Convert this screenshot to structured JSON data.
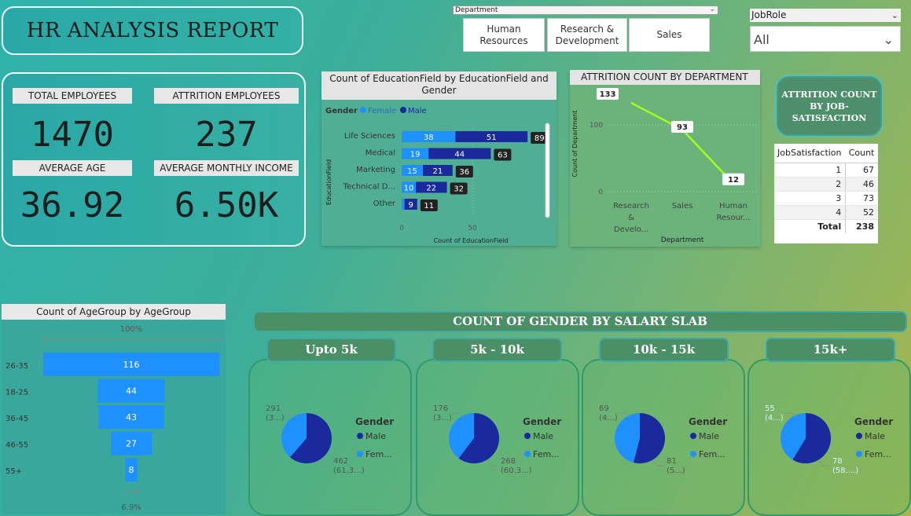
{
  "title": "HR ANALYSIS REPORT",
  "department_slicer": {
    "label": "Department",
    "options": [
      "Human Resources",
      "Research & Development",
      "Sales"
    ]
  },
  "jobrole_slicer": {
    "label": "JobRole",
    "value": "All"
  },
  "kpis": {
    "total_employees": {
      "label": "TOTAL EMPLOYEES",
      "value": "1470"
    },
    "attrition_employees": {
      "label": "ATTRITION EMPLOYEES",
      "value": "237"
    },
    "average_age": {
      "label": "AVERAGE AGE",
      "value": "36.92"
    },
    "average_monthly_income": {
      "label": "AVERAGE MONTHLY INCOME",
      "value": "6.50K"
    }
  },
  "colors": {
    "female": "#1e90ff",
    "male": "#1a2a9c",
    "line": "#a6ff1a"
  },
  "chart_data": [
    {
      "type": "bar",
      "title": "Count of EducationField by EducationField and Gender",
      "legend_title": "Gender",
      "legend": [
        "Female",
        "Male"
      ],
      "ylabel": "EducationField",
      "xlabel": "Count of EducationField",
      "x_ticks": [
        "0",
        "50"
      ],
      "xlim": [
        0,
        100
      ],
      "categories": [
        "Life Sciences",
        "Medical",
        "Marketing",
        "Technical D...",
        "Other"
      ],
      "series": [
        {
          "name": "Female",
          "values": [
            38,
            19,
            15,
            10,
            2
          ]
        },
        {
          "name": "Male",
          "values": [
            51,
            44,
            21,
            22,
            9
          ]
        }
      ],
      "totals": [
        89,
        63,
        36,
        32,
        11
      ],
      "segment_labels": [
        [
          "38",
          "51"
        ],
        [
          "19",
          "44"
        ],
        [
          "15",
          "21"
        ],
        [
          "10",
          "22"
        ],
        [
          "",
          "9"
        ]
      ]
    },
    {
      "type": "line",
      "title": "ATTRITION COUNT BY DEPARTMENT",
      "xlabel": "Department",
      "ylabel": "Count of Department",
      "categories": [
        "Research & Develo...",
        "Sales",
        "Human Resour..."
      ],
      "category_lines": [
        [
          "Research",
          "&",
          "Develo..."
        ],
        [
          "Sales"
        ],
        [
          "Human",
          "Resour..."
        ]
      ],
      "values": [
        133,
        93,
        12
      ],
      "y_ticks": [
        "0",
        "100"
      ],
      "ylim": [
        0,
        150
      ]
    },
    {
      "type": "table",
      "title": "ATTRITION COUNT BY JOB-SATISFACTION",
      "columns": [
        "JobSatisfaction",
        "Count"
      ],
      "rows": [
        [
          "1",
          "67"
        ],
        [
          "2",
          "46"
        ],
        [
          "3",
          "73"
        ],
        [
          "4",
          "52"
        ]
      ],
      "total_label": "Total",
      "total_value": "238"
    },
    {
      "type": "bar",
      "title": "Count of AgeGroup by AgeGroup",
      "top_pct": "100%",
      "bottom_pct": "6.9%",
      "categories": [
        "26-35",
        "18-25",
        "36-45",
        "46-55",
        "55+"
      ],
      "values": [
        116,
        44,
        43,
        27,
        8
      ]
    },
    {
      "type": "pie",
      "title": "COUNT OF GENDER BY SALARY SLAB",
      "legend_title": "Gender",
      "legend": [
        "Male",
        "Fem..."
      ],
      "slabs": [
        {
          "name": "Upto 5k",
          "female": 291,
          "male": 462,
          "female_label": [
            "291",
            "(3...)"
          ],
          "male_label": [
            "462",
            "(61.3...)"
          ]
        },
        {
          "name": "5k - 10k",
          "female": 176,
          "male": 268,
          "female_label": [
            "176",
            "(3...)"
          ],
          "male_label": [
            "268",
            "(60.3...)"
          ]
        },
        {
          "name": "10k - 15k",
          "female": 69,
          "male": 81,
          "female_label": [
            "69",
            "(4...)"
          ],
          "male_label": [
            "81",
            "(5...)"
          ]
        },
        {
          "name": "15k+",
          "female": 55,
          "male": 78,
          "female_label": [
            "55",
            "(4...)"
          ],
          "male_label": [
            "78",
            "(58....)"
          ]
        }
      ]
    }
  ]
}
